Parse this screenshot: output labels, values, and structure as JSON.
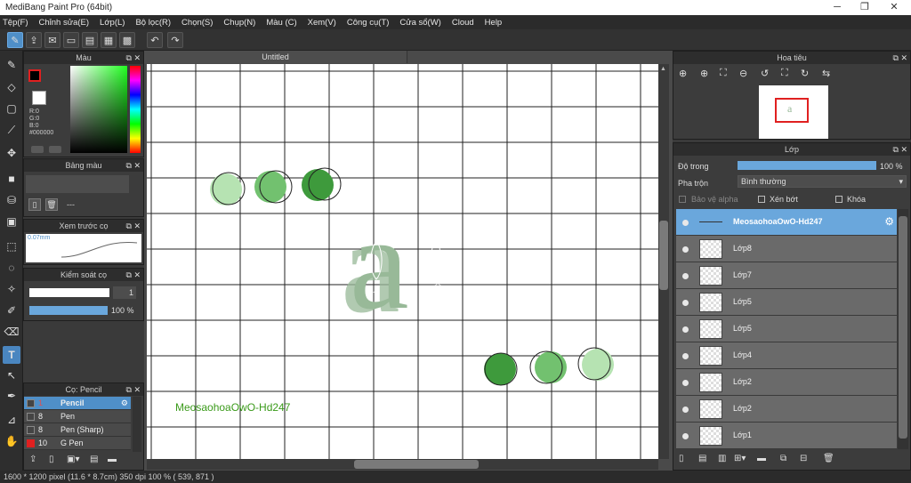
{
  "window": {
    "title": "MediBang Paint Pro (64bit)"
  },
  "menu": [
    "Tệp(F)",
    "Chỉnh sửa(E)",
    "Lớp(L)",
    "Bộ lọc(R)",
    "Chọn(S)",
    "Chụp(N)",
    "Màu (C)",
    "Xem(V)",
    "Công cụ(T)",
    "Cửa sổ(W)",
    "Cloud",
    "Help"
  ],
  "color_panel": {
    "title": "Màu",
    "r": "R:0",
    "g": "G:0",
    "b": "B:0",
    "hex": "#000000"
  },
  "palette_panel": {
    "title": "Bảng màu",
    "empty_label": "---"
  },
  "brush_preview_panel": {
    "title": "Xem trước cọ",
    "size_label": "0.07mm"
  },
  "brush_control_panel": {
    "title": "Kiểm soát cọ",
    "size_value": "1",
    "opacity_value": "100 %",
    "opacity": 1.0
  },
  "brush_panel": {
    "title": "Cọ: Pencil",
    "items": [
      {
        "size": "1",
        "name": "Pencil",
        "color": "#2b5fa0"
      },
      {
        "size": "8",
        "name": "Pen",
        "color": "#444444"
      },
      {
        "size": "8",
        "name": "Pen (Sharp)",
        "color": "#444444"
      },
      {
        "size": "10",
        "name": "G Pen",
        "color": "#e02020"
      }
    ]
  },
  "canvas": {
    "tab_title": "Untitled",
    "watermark_text": "MeosaohoaOwO-Hd247",
    "glyph": "a",
    "dot_colors": {
      "light": "#b6e3b2",
      "mid": "#72c16f",
      "dark": "#3e9a3c",
      "glyph": "#98b998"
    }
  },
  "navigator_panel": {
    "title": "Hoa tiêu"
  },
  "layer_panel": {
    "title": "Lớp",
    "opacity_label": "Độ trong",
    "opacity_value": "100 %",
    "opacity": 1.0,
    "blend_label": "Pha trộn",
    "blend_value": "Bình thường",
    "protect_alpha": "Bảo vệ alpha",
    "clipping": "Xén bớt",
    "lock": "Khóa",
    "layers": [
      "MeosaohoaOwO-Hd247",
      "Lớp8",
      "Lớp7",
      "Lớp5",
      "Lớp5",
      "Lớp4",
      "Lớp2",
      "Lớp2",
      "Lớp1"
    ]
  },
  "status": {
    "text": "1600 * 1200 pixel   (11.6 * 8.7cm)   350 dpi   100 %   ( 539, 871 )"
  }
}
